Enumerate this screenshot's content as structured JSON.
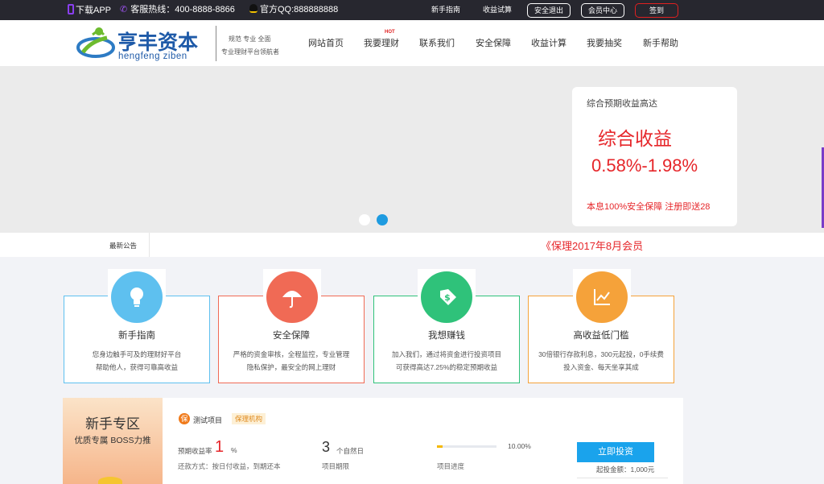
{
  "topbar": {
    "download_app": "下载APP",
    "hotline": "客服热线：400-8888-8866",
    "qq": "官方QQ:888888888",
    "guide": "新手指南",
    "calc": "收益试算",
    "logout": "安全退出",
    "member": "会员中心",
    "signin": "签到"
  },
  "logo": {
    "name": "亨丰资本",
    "pinyin": "hengfeng ziben",
    "slogan1": "规范 专业 全面",
    "slogan2": "专业理财平台领航者"
  },
  "nav": [
    "网站首页",
    "我要理财",
    "联系我们",
    "安全保障",
    "收益计算",
    "我要抽奖",
    "新手帮助"
  ],
  "nav_hot": "HOT",
  "banner_card": {
    "subtitle": "综合预期收益高达",
    "title": "综合收益",
    "rate": "0.58%-1.98%",
    "footer": "本息100%安全保障 注册即送28"
  },
  "notice": {
    "label": "最新公告",
    "text": "《保理2017年8月会员"
  },
  "features": [
    {
      "title": "新手指南",
      "desc1": "您身边触手可及的理财好平台",
      "desc2": "帮助他人，获得可靠高收益",
      "color": "#5ec0ef",
      "icon": "lightbulb-icon"
    },
    {
      "title": "安全保障",
      "desc1": "严格的资金审核，全程监控，专业管理",
      "desc2": "隐私保护，最安全的网上理财",
      "color": "#f06a55",
      "icon": "umbrella-icon"
    },
    {
      "title": "我想赚钱",
      "desc1": "加入我们，通过将资金进行投资项目",
      "desc2": "可获得高达7.25%的稳定预期收益",
      "color": "#2fc27a",
      "icon": "money-tag-icon"
    },
    {
      "title": "高收益低门槛",
      "desc1": "30倍银行存款利息，300元起投，0手续费",
      "desc2": "投入资金、每天坐享其成",
      "color": "#f5a23a",
      "icon": "chart-icon"
    }
  ],
  "promo": {
    "title": "新手专区",
    "subtitle": "优质专属 BOSS力推"
  },
  "product": {
    "badge": "保",
    "name": "测试项目",
    "tag": "保理机构",
    "rate_label": "预期收益率",
    "rate_value": "1",
    "rate_unit": "%",
    "repay": "还款方式：按日付收益，到期还本",
    "term_value": "3",
    "term_unit": "个自然日",
    "term_label": "项目期限",
    "progress_pct": "10.00%",
    "progress": 0.1,
    "progress_label": "项目进度",
    "invest_button": "立即投资",
    "min_amount": "起投金额：1,000元"
  }
}
